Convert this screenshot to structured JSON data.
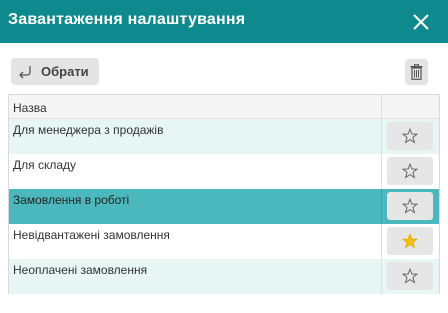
{
  "dialog": {
    "title": "Завантаження налаштування"
  },
  "toolbar": {
    "select_label": "Обрати"
  },
  "table": {
    "header_name": "Назва",
    "rows": [
      {
        "name": "Для менеджера з продажів",
        "favorite": false,
        "selected": false
      },
      {
        "name": "Для складу",
        "favorite": false,
        "selected": false
      },
      {
        "name": "Замовлення в роботі",
        "favorite": false,
        "selected": true
      },
      {
        "name": "Невідвантажені замовлення",
        "favorite": true,
        "selected": false
      },
      {
        "name": "Неоплачені замовлення",
        "favorite": false,
        "selected": false
      }
    ]
  },
  "colors": {
    "header_bg": "#0e8a8e",
    "selected_row": "#4bb8bd",
    "alt_row": "#e8f5f5",
    "star_active": "#f4c20d"
  }
}
